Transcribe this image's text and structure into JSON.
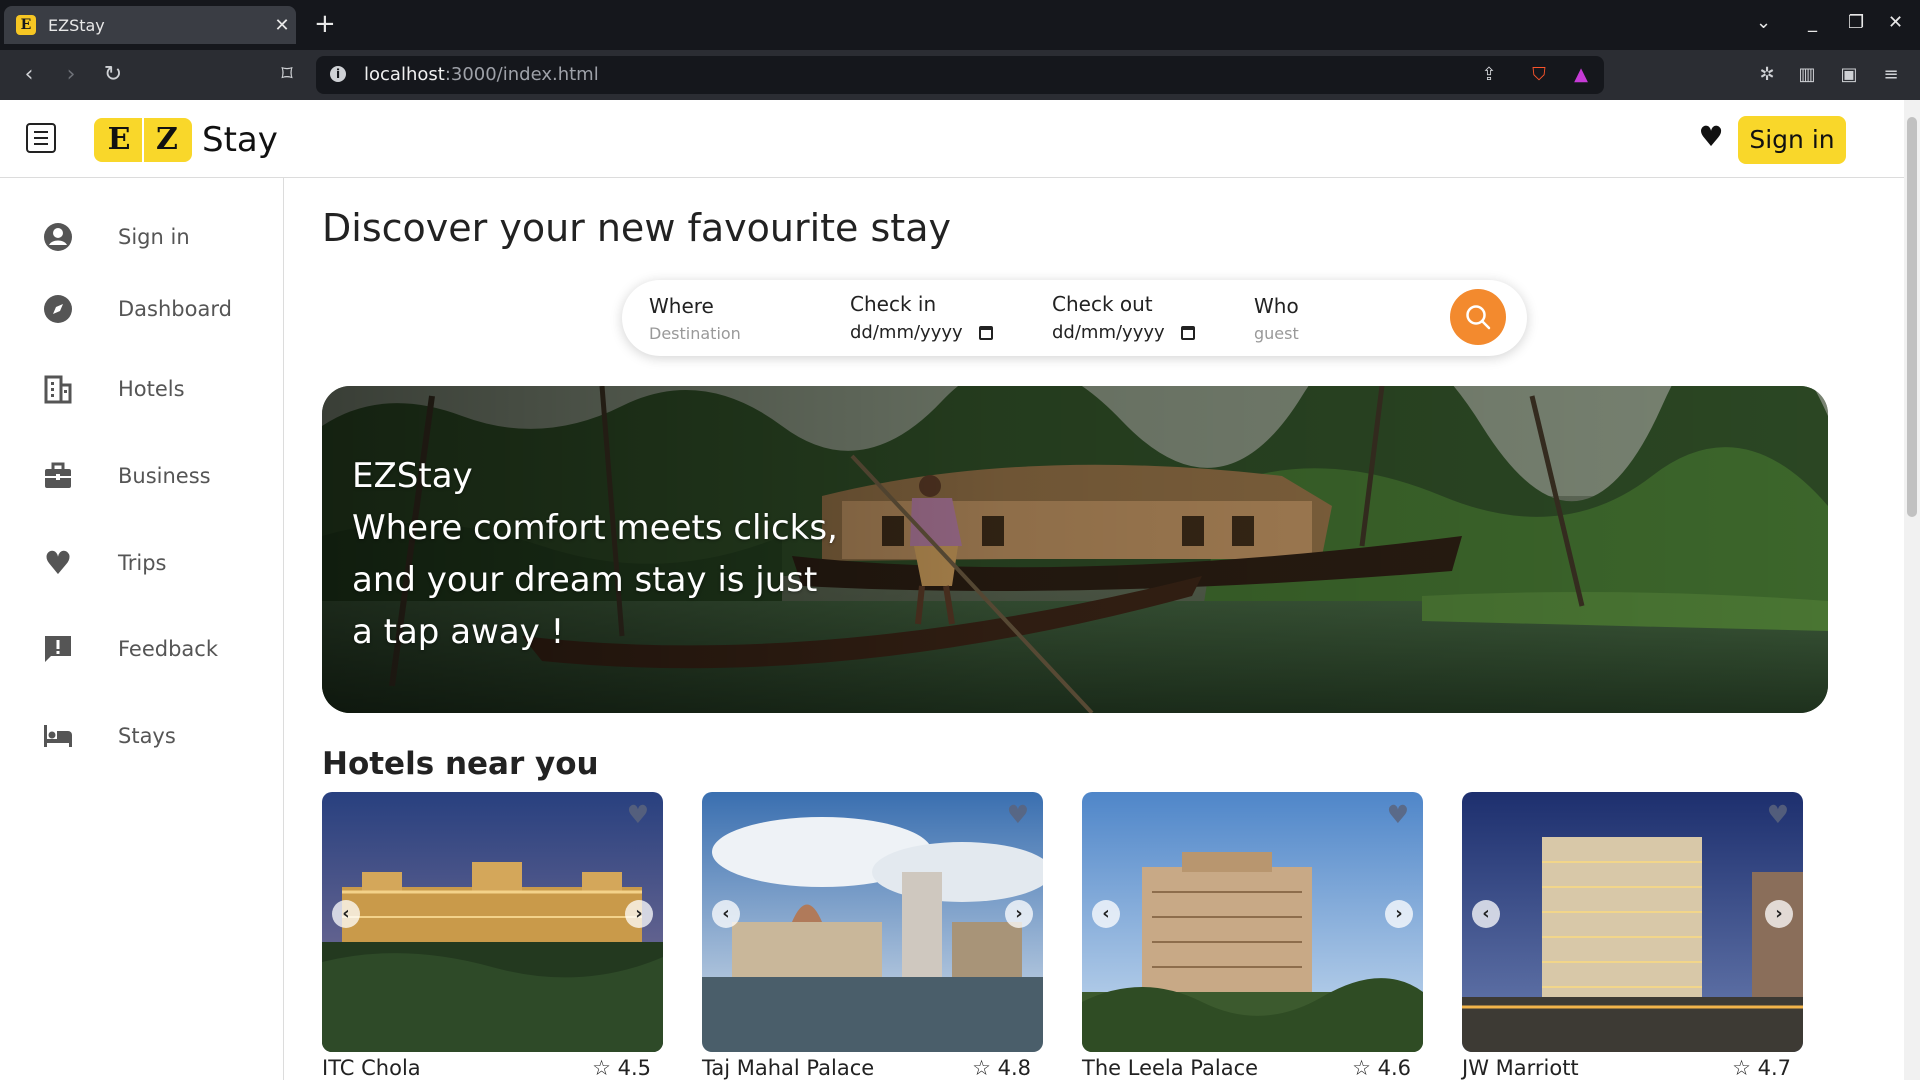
{
  "browser": {
    "tab_title": "EZStay",
    "tab_favicon": "E",
    "tab_close": "✕",
    "new_tab": "+",
    "url_host": "localhost",
    "url_path": ":3000/index.html"
  },
  "header": {
    "logo_letters": [
      "E",
      "Z"
    ],
    "logo_text": "Stay",
    "signin_label": "Sign in"
  },
  "sidebar": {
    "items": [
      {
        "label": "Sign in",
        "icon": "account-circle-icon"
      },
      {
        "label": "Dashboard",
        "icon": "compass-icon"
      },
      {
        "label": "Hotels",
        "icon": "building-icon"
      },
      {
        "label": "Business",
        "icon": "briefcase-icon"
      },
      {
        "label": "Trips",
        "icon": "heart-icon"
      },
      {
        "label": "Feedback",
        "icon": "feedback-icon"
      },
      {
        "label": "Stays",
        "icon": "bed-icon"
      }
    ]
  },
  "main": {
    "title": "Discover your new favourite stay",
    "search": {
      "where_label": "Where",
      "where_placeholder": "Destination",
      "checkin_label": "Check in",
      "checkin_value": "dd/mm/yyyy",
      "checkout_label": "Check out",
      "checkout_value": "dd/mm/yyyy",
      "who_label": "Who",
      "who_placeholder": "guest"
    },
    "hero": {
      "lines": [
        "EZStay",
        "Where comfort meets clicks,",
        "and your dream stay is just",
        "a tap away !"
      ]
    },
    "section_title": "Hotels near you",
    "hotels": [
      {
        "name": "ITC Chola",
        "rating": "4.5"
      },
      {
        "name": "Taj Mahal Palace",
        "rating": "4.8"
      },
      {
        "name": "The Leela Palace",
        "rating": "4.6"
      },
      {
        "name": "JW Marriott",
        "rating": "4.7"
      }
    ]
  },
  "colors": {
    "brand_yellow": "#f9d72a",
    "search_orange": "#f38a2e"
  }
}
